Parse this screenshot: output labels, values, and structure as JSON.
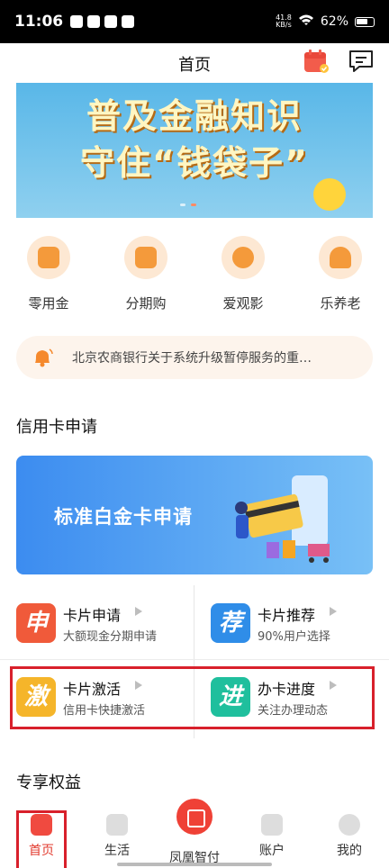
{
  "status_bar": {
    "time": "11:06",
    "speed_top": "41.8",
    "speed_unit": "KB/s",
    "battery": "62%"
  },
  "header": {
    "title": "首页"
  },
  "banner": {
    "line1": "普及金融知识",
    "line2": "守住“钱袋子”"
  },
  "quick_menu": [
    {
      "label": "零用金",
      "icon": "money-bag-icon"
    },
    {
      "label": "分期购",
      "icon": "installment-cart-icon"
    },
    {
      "label": "爱观影",
      "icon": "film-reel-icon"
    },
    {
      "label": "乐养老",
      "icon": "elderly-person-icon"
    }
  ],
  "notice": {
    "text": "北京农商银行关于系统升级暂停服务的重…"
  },
  "credit_section": {
    "title": "信用卡申请",
    "banner_text": "标准白金卡申请",
    "items": [
      {
        "icon_char": "申",
        "title": "卡片申请",
        "subtitle": "大额现金分期申请",
        "color": "#f05a3a"
      },
      {
        "icon_char": "荐",
        "title": "卡片推荐",
        "subtitle": "90%用户选择",
        "color": "#2f8de8"
      },
      {
        "icon_char": "激",
        "title": "卡片激活",
        "subtitle": "信用卡快捷激活",
        "color": "#f5b52a"
      },
      {
        "icon_char": "进",
        "title": "办卡进度",
        "subtitle": "关注办理动态",
        "color": "#1fbf9d"
      }
    ]
  },
  "benefits_section": {
    "title": "专享权益"
  },
  "tabbar": {
    "tabs": [
      {
        "label": "首页"
      },
      {
        "label": "生活"
      },
      {
        "label": "凤凰智付"
      },
      {
        "label": "账户"
      },
      {
        "label": "我的"
      }
    ]
  },
  "colors": {
    "accent": "#e23a2e",
    "highlight_border": "#d8202b"
  }
}
